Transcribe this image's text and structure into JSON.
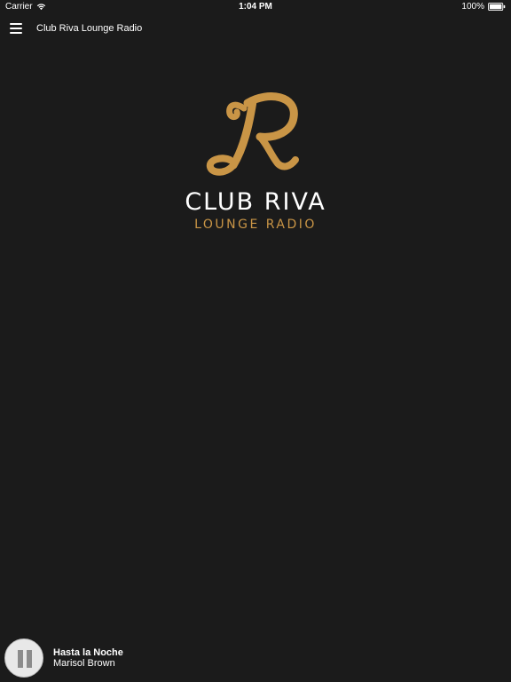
{
  "status_bar": {
    "carrier": "Carrier",
    "time": "1:04 PM",
    "battery": "100%",
    "icons": [
      "wifi-icon",
      "battery-icon"
    ]
  },
  "header": {
    "title": "Club Riva Lounge Radio",
    "menu_icon": "hamburger-menu-icon"
  },
  "logo": {
    "name": "CLUB RIVA",
    "subtitle": "LOUNGE RADIO",
    "mark_glyph": "R"
  },
  "colors": {
    "background": "#1b1b1b",
    "accent_gold": "#c99546",
    "text": "#ffffff"
  },
  "player": {
    "track_title": "Hasta la Noche",
    "track_artist": "Marisol Brown",
    "control_icon": "pause-icon"
  }
}
